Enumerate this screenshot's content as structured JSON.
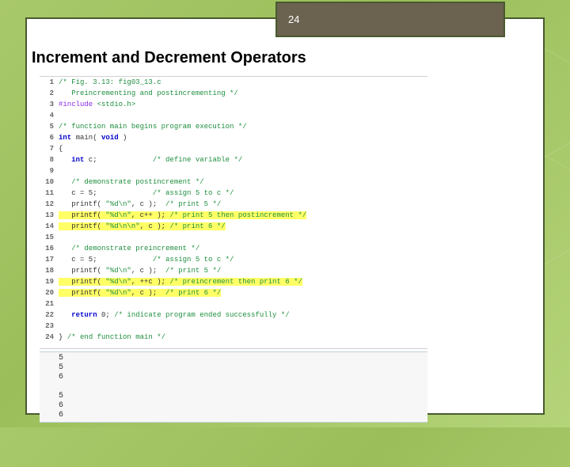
{
  "slide": {
    "number": "24",
    "title": "Increment and Decrement Operators"
  },
  "code": {
    "lines": [
      {
        "n": "1",
        "segs": [
          [
            "c-comment",
            "/* Fig. 3.13: fig03_13.c"
          ]
        ]
      },
      {
        "n": "2",
        "segs": [
          [
            "c-comment",
            "   Preincrementing and postincrementing */"
          ]
        ]
      },
      {
        "n": "3",
        "segs": [
          [
            "c-preproc",
            "#include "
          ],
          [
            "c-include",
            "<stdio.h>"
          ]
        ]
      },
      {
        "n": "4",
        "segs": [
          [
            "",
            ""
          ]
        ]
      },
      {
        "n": "5",
        "segs": [
          [
            "c-comment",
            "/* function main begins program execution */"
          ]
        ]
      },
      {
        "n": "6",
        "segs": [
          [
            "c-keyword",
            "int"
          ],
          [
            "",
            " main( "
          ],
          [
            "c-keyword",
            "void"
          ],
          [
            "",
            " )"
          ]
        ]
      },
      {
        "n": "7",
        "segs": [
          [
            "",
            "{"
          ]
        ]
      },
      {
        "n": "8",
        "segs": [
          [
            "",
            "   "
          ],
          [
            "c-keyword",
            "int"
          ],
          [
            "",
            " c;             "
          ],
          [
            "c-comment",
            "/* define variable */"
          ]
        ]
      },
      {
        "n": "9",
        "segs": [
          [
            "",
            ""
          ]
        ]
      },
      {
        "n": "10",
        "segs": [
          [
            "",
            "   "
          ],
          [
            "c-comment",
            "/* demonstrate postincrement */"
          ]
        ]
      },
      {
        "n": "11",
        "segs": [
          [
            "",
            "   c = 5;             "
          ],
          [
            "c-comment",
            "/* assign 5 to c */"
          ]
        ]
      },
      {
        "n": "12",
        "segs": [
          [
            "",
            "   printf( "
          ],
          [
            "c-string",
            "\"%d\\n\""
          ],
          [
            "",
            ", c );  "
          ],
          [
            "c-comment",
            "/* print 5 */"
          ]
        ]
      },
      {
        "n": "13",
        "hl": true,
        "segs": [
          [
            "",
            "   printf( "
          ],
          [
            "c-string",
            "\"%d\\n\""
          ],
          [
            "",
            ", c++ ); "
          ],
          [
            "c-comment",
            "/* print 5 then postincrement */"
          ]
        ]
      },
      {
        "n": "14",
        "hl": true,
        "segs": [
          [
            "",
            "   printf( "
          ],
          [
            "c-string",
            "\"%d\\n\\n\""
          ],
          [
            "",
            ", c ); "
          ],
          [
            "c-comment",
            "/* print 6 */"
          ]
        ]
      },
      {
        "n": "15",
        "segs": [
          [
            "",
            ""
          ]
        ]
      },
      {
        "n": "16",
        "segs": [
          [
            "",
            "   "
          ],
          [
            "c-comment",
            "/* demonstrate preincrement */"
          ]
        ]
      },
      {
        "n": "17",
        "segs": [
          [
            "",
            "   c = 5;             "
          ],
          [
            "c-comment",
            "/* assign 5 to c */"
          ]
        ]
      },
      {
        "n": "18",
        "segs": [
          [
            "",
            "   printf( "
          ],
          [
            "c-string",
            "\"%d\\n\""
          ],
          [
            "",
            ", c );  "
          ],
          [
            "c-comment",
            "/* print 5 */"
          ]
        ]
      },
      {
        "n": "19",
        "hl": true,
        "segs": [
          [
            "",
            "   printf( "
          ],
          [
            "c-string",
            "\"%d\\n\""
          ],
          [
            "",
            ", ++c ); "
          ],
          [
            "c-comment",
            "/* preincrement then print 6 */"
          ]
        ]
      },
      {
        "n": "20",
        "hl": true,
        "segs": [
          [
            "",
            "   printf( "
          ],
          [
            "c-string",
            "\"%d\\n\""
          ],
          [
            "",
            ", c );  "
          ],
          [
            "c-comment",
            "/* print 6 */"
          ]
        ]
      },
      {
        "n": "21",
        "segs": [
          [
            "",
            ""
          ]
        ]
      },
      {
        "n": "22",
        "segs": [
          [
            "",
            "   "
          ],
          [
            "c-keyword",
            "return"
          ],
          [
            "",
            " 0; "
          ],
          [
            "c-comment",
            "/* indicate program ended successfully */"
          ]
        ]
      },
      {
        "n": "23",
        "segs": [
          [
            "",
            ""
          ]
        ]
      },
      {
        "n": "24",
        "segs": [
          [
            "",
            "} "
          ],
          [
            "c-comment",
            "/* end function main */"
          ]
        ]
      }
    ]
  },
  "output": {
    "lines": [
      "5",
      "5",
      "6",
      "",
      "5",
      "6",
      "6"
    ]
  }
}
